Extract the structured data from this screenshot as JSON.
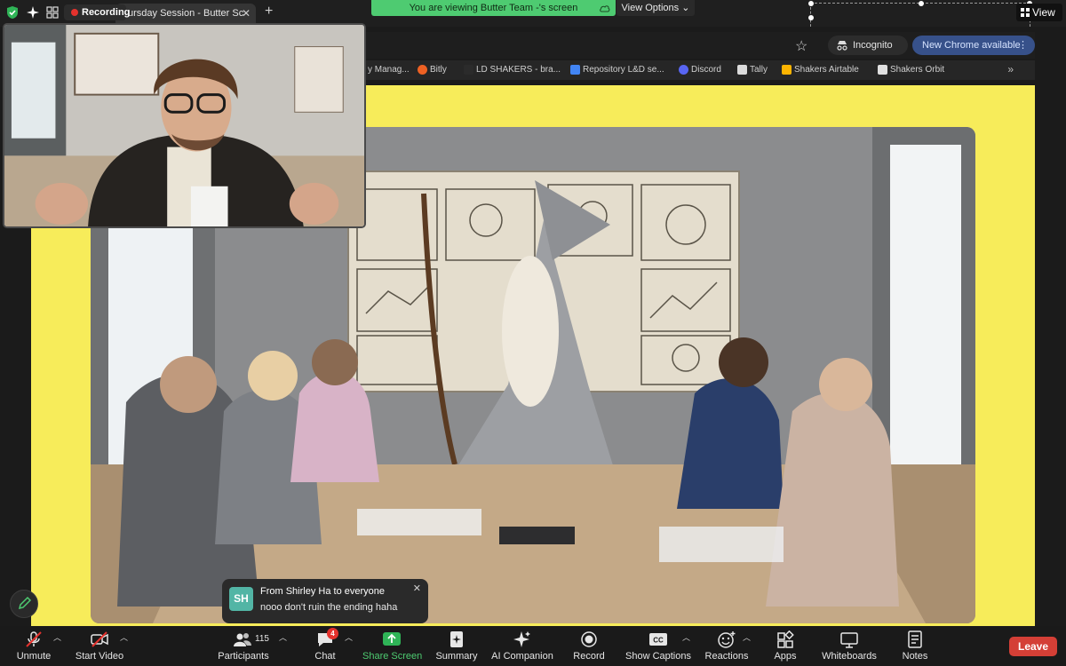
{
  "meeting_header": {
    "recording_label": "Recording",
    "browser_tab_title": "ursday Session - Butter Sc",
    "new_tab_label": "+",
    "share_banner": "You are viewing Butter Team -'s screen",
    "view_options": "View Options",
    "view_button": "View"
  },
  "chrome": {
    "incognito_label": "Incognito",
    "update_label": "New Chrome available",
    "bookmarks": [
      {
        "label": "y Manag...",
        "icon_color": "#7a7a7a"
      },
      {
        "label": "Bitly",
        "icon_color": "#ee6123"
      },
      {
        "label": "LD SHAKERS - bra...",
        "icon_color": "#2b2b2b"
      },
      {
        "label": "Repository L&D se...",
        "icon_color": "#4285f4"
      },
      {
        "label": "Discord",
        "icon_color": "#5865f2"
      },
      {
        "label": "Tally",
        "icon_color": "#dcdcdc"
      },
      {
        "label": "Shakers Airtable",
        "icon_color": "#fcb400"
      },
      {
        "label": "Shakers Orbit",
        "icon_color": "#e0e0e0"
      }
    ]
  },
  "slide": {
    "background_color": "#f7ec5a"
  },
  "chat_notification": {
    "avatar_initials": "SH",
    "from": "From Shirley Ha to everyone",
    "message": "nooo don't ruin the ending haha"
  },
  "toolbar": {
    "unmute": "Unmute",
    "start_video": "Start Video",
    "participants": "Participants",
    "participants_count": "115",
    "chat": "Chat",
    "chat_badge": "4",
    "share_screen": "Share Screen",
    "summary": "Summary",
    "ai_companion": "AI Companion",
    "record": "Record",
    "show_captions": "Show Captions",
    "reactions": "Reactions",
    "apps": "Apps",
    "whiteboards": "Whiteboards",
    "notes": "Notes",
    "leave": "Leave"
  },
  "colors": {
    "share_green": "#4ecb71",
    "leave_red": "#d43f36",
    "recording_red": "#e5322d",
    "chrome_blue": "#37518a"
  }
}
